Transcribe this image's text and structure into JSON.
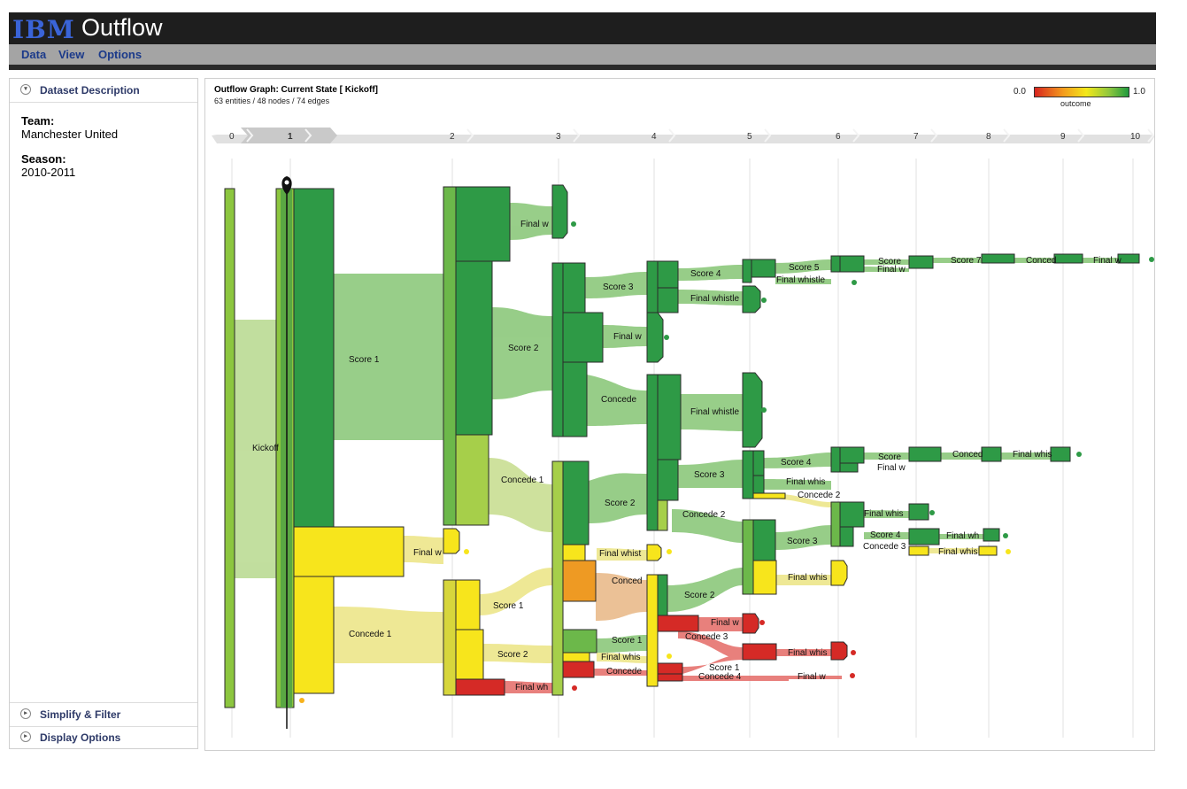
{
  "app": {
    "brand": "IBM",
    "title": "Outflow"
  },
  "menu": [
    "Data",
    "View",
    "Options"
  ],
  "sidebar": {
    "dataset_header": "Dataset Description",
    "team_label": "Team:",
    "team_value": "Manchester United",
    "season_label": "Season:",
    "season_value": "2010-2011",
    "simplify_header": "Simplify & Filter",
    "display_header": "Display Options"
  },
  "graph": {
    "title": "Outflow Graph: Current State [ Kickoff]",
    "subtitle": "63 entities / 48 nodes / 74 edges",
    "legend": {
      "min": "0.0",
      "max": "1.0",
      "label": "outcome"
    },
    "steps": [
      "0",
      "1",
      "2",
      "3",
      "4",
      "5",
      "6",
      "7",
      "8",
      "9",
      "10"
    ],
    "current_step": "1"
  },
  "colors": {
    "dark_green": "#2e9a46",
    "mid_green": "#6cb84a",
    "light_green": "#a6cf7a",
    "yellow": "#f7e51c",
    "orange": "#ee9a23",
    "red": "#d52a26",
    "flow_green": "#86c574",
    "flow_yellow": "#ece483",
    "flow_red": "#e46a66"
  },
  "labels": {
    "kickoff": "Kickoff",
    "score1": "Score 1",
    "concede1": "Concede 1",
    "final_whistle": "Final whistle",
    "score2": "Score 2",
    "score3": "Score 3",
    "score4": "Score 4",
    "score5": "Score 5",
    "concede2": "Concede 2",
    "concede3": "Concede 3",
    "concede4": "Concede 4",
    "score": "Score",
    "score7": "Score 7",
    "concede": "Conced",
    "concede_short": "Concede",
    "concede1_short": "Concede 1",
    "fw_a": "Final w",
    "fw_b": "Final whis",
    "fw_c": "Final whist",
    "fw_d": "Final whistle",
    "fw_e": "Final w",
    "fw_f": "Final wh",
    "concede_trunc": "Conced",
    "concede_trunc2": "Concede"
  }
}
